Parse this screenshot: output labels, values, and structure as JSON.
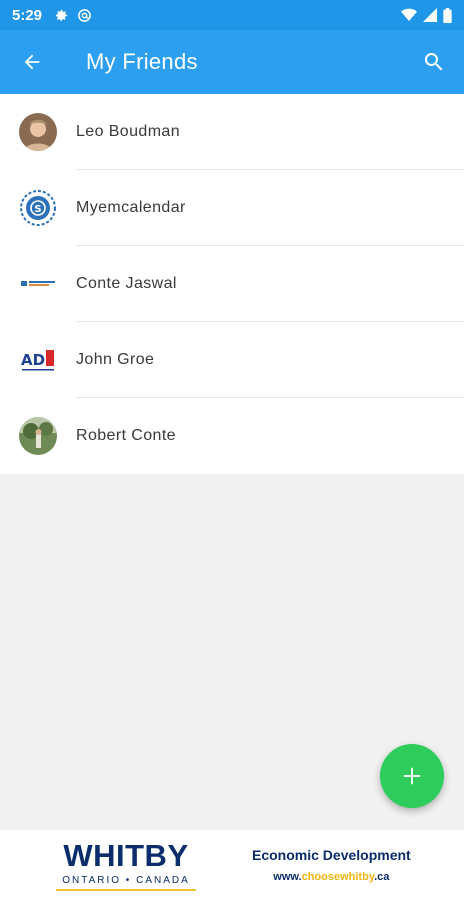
{
  "status_bar": {
    "time": "5:29",
    "icons": [
      "gear-icon",
      "at-sign-icon",
      "wifi-icon",
      "cell-signal-icon",
      "battery-icon"
    ]
  },
  "app_bar": {
    "title": "My Friends",
    "back_icon": "arrow-left-icon",
    "search_icon": "search-icon",
    "color": "#2c9ff0"
  },
  "friends": [
    {
      "name": "Leo Boudman",
      "avatar": "photo-avatar"
    },
    {
      "name": "Myemcalendar",
      "avatar": "blue-seal-logo"
    },
    {
      "name": "Conte Jaswal",
      "avatar": "small-text-logo"
    },
    {
      "name": "John Groe",
      "avatar": "ad-logo"
    },
    {
      "name": "Robert Conte",
      "avatar": "outdoor-photo-avatar"
    }
  ],
  "fab": {
    "icon": "plus-icon",
    "color": "#2ecc5a"
  },
  "footer": {
    "brand": "WHITBY",
    "region": "ONTARIO • CANADA",
    "tagline": "Economic Development",
    "url_prefix": "www.",
    "url_highlight": "choosewhitby",
    "url_suffix": ".ca"
  }
}
